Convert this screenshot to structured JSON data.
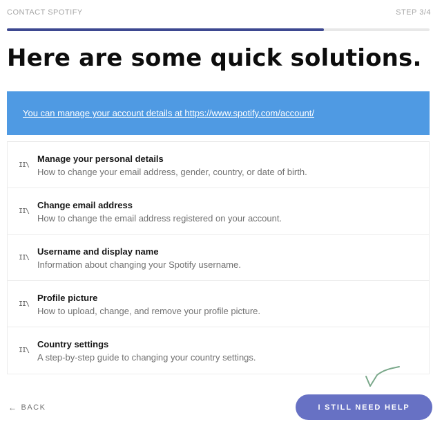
{
  "header": {
    "title": "CONTACT SPOTIFY",
    "step": "STEP 3/4",
    "progress_percent": 75
  },
  "page_title": "Here are some quick solutions.",
  "banner": {
    "link_text": "You can manage your account details at https://www.spotify.com/account/"
  },
  "solutions": [
    {
      "icon": "article-icon",
      "title": "Manage your personal details",
      "description": "How to change your email address, gender, country, or date of birth."
    },
    {
      "icon": "article-icon",
      "title": "Change email address",
      "description": "How to change the email address registered on your account."
    },
    {
      "icon": "article-icon",
      "title": "Username and display name",
      "description": "Information about changing your Spotify username."
    },
    {
      "icon": "article-icon",
      "title": "Profile picture",
      "description": "How to upload, change, and remove your profile picture."
    },
    {
      "icon": "article-icon",
      "title": "Country settings",
      "description": "A step-by-step guide to changing your country settings."
    }
  ],
  "footer": {
    "back_label": "BACK",
    "help_label": "I STILL NEED HELP"
  },
  "colors": {
    "progress": "#3d4890",
    "banner": "#4f9ae3",
    "help_button": "#6771c4",
    "annotation_check": "#7aa88a"
  }
}
